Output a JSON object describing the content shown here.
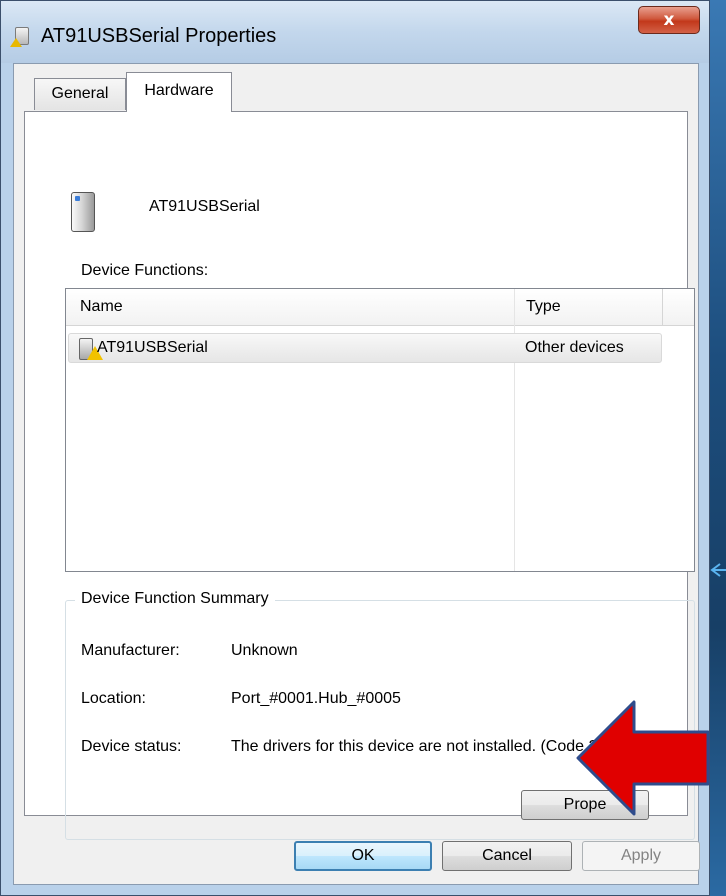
{
  "window": {
    "title": "AT91USBSerial Properties",
    "close_label": "x"
  },
  "tabs": [
    {
      "label": "General",
      "selected": false
    },
    {
      "label": "Hardware",
      "selected": true
    }
  ],
  "device": {
    "name": "AT91USBSerial"
  },
  "device_functions": {
    "label": "Device Functions:",
    "columns": [
      "Name",
      "Type"
    ],
    "rows": [
      {
        "name": "AT91USBSerial",
        "type": "Other devices",
        "icon": "warning-device-icon"
      }
    ]
  },
  "summary": {
    "title": "Device Function Summary",
    "manufacturer_label": "Manufacturer:",
    "manufacturer_value": "Unknown",
    "location_label": "Location:",
    "location_value": "Port_#0001.Hub_#0005",
    "status_label": "Device status:",
    "status_value": "The drivers for this device are not installed. (Code 28)",
    "properties_button": "Prope"
  },
  "buttons": {
    "ok": "OK",
    "cancel": "Cancel",
    "apply": "Apply"
  },
  "annotation": {
    "arrow_color": "#e00000",
    "arrow_outline": "#2f4c8c"
  }
}
